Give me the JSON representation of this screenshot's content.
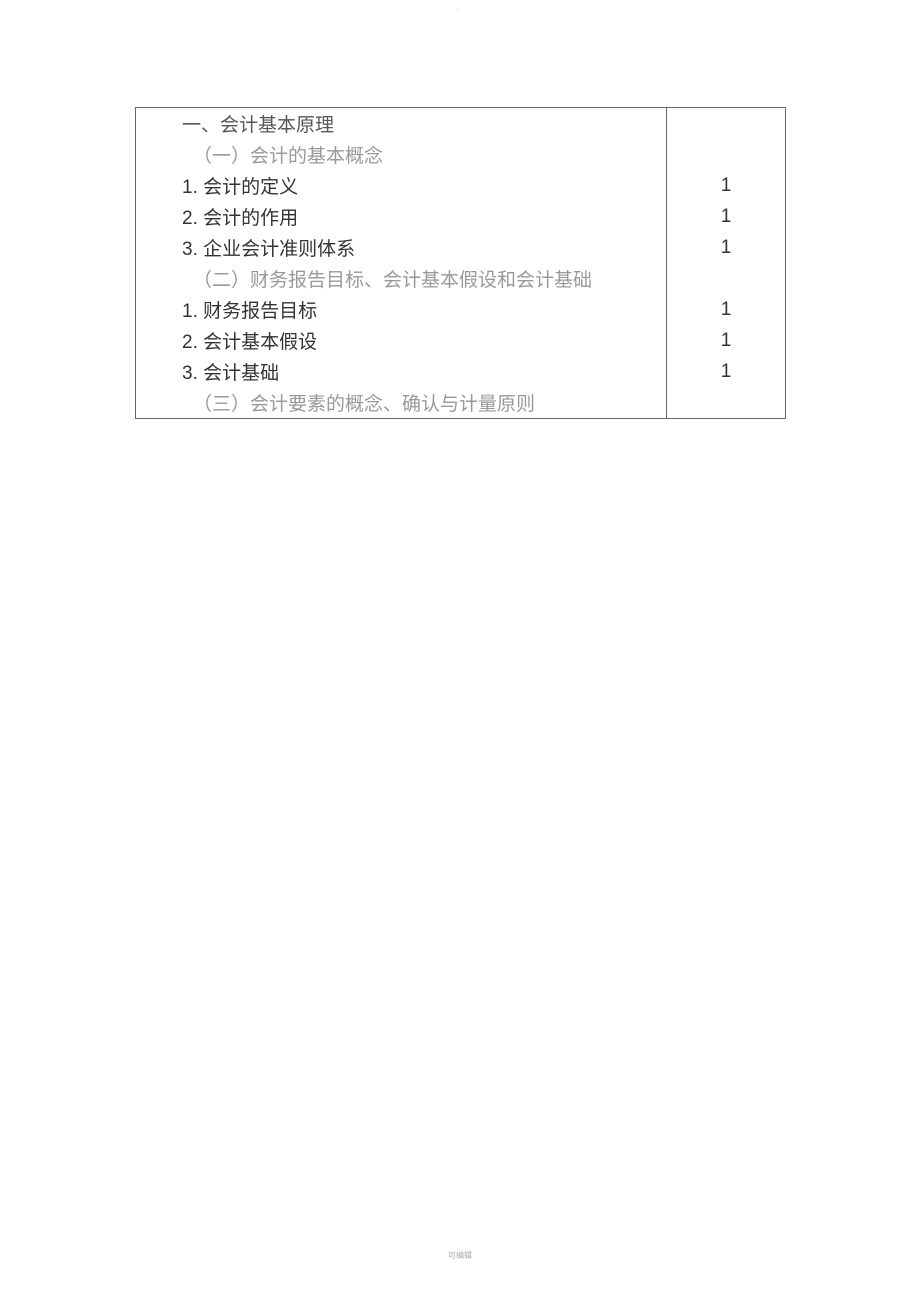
{
  "header_dot": ".",
  "toc": {
    "rows": [
      {
        "text": "一、会计基本原理",
        "type": "heading-main",
        "page": ""
      },
      {
        "text": "（一）会计的基本概念",
        "type": "heading-sub",
        "page": ""
      },
      {
        "text": "1. 会计的定义",
        "type": "item",
        "page": "1"
      },
      {
        "text": "2. 会计的作用",
        "type": "item",
        "page": "1"
      },
      {
        "text": "3. 企业会计准则体系",
        "type": "item",
        "page": "1"
      },
      {
        "text": "（二）财务报告目标、会计基本假设和会计基础",
        "type": "heading-sub",
        "page": ""
      },
      {
        "text": "1. 财务报告目标",
        "type": "item",
        "page": "1"
      },
      {
        "text": "2. 会计基本假设",
        "type": "item",
        "page": "1"
      },
      {
        "text": "3. 会计基础",
        "type": "item",
        "page": "1"
      },
      {
        "text": "（三）会计要素的概念、确认与计量原则",
        "type": "heading-sub",
        "page": ""
      }
    ]
  },
  "footer": "可编辑"
}
